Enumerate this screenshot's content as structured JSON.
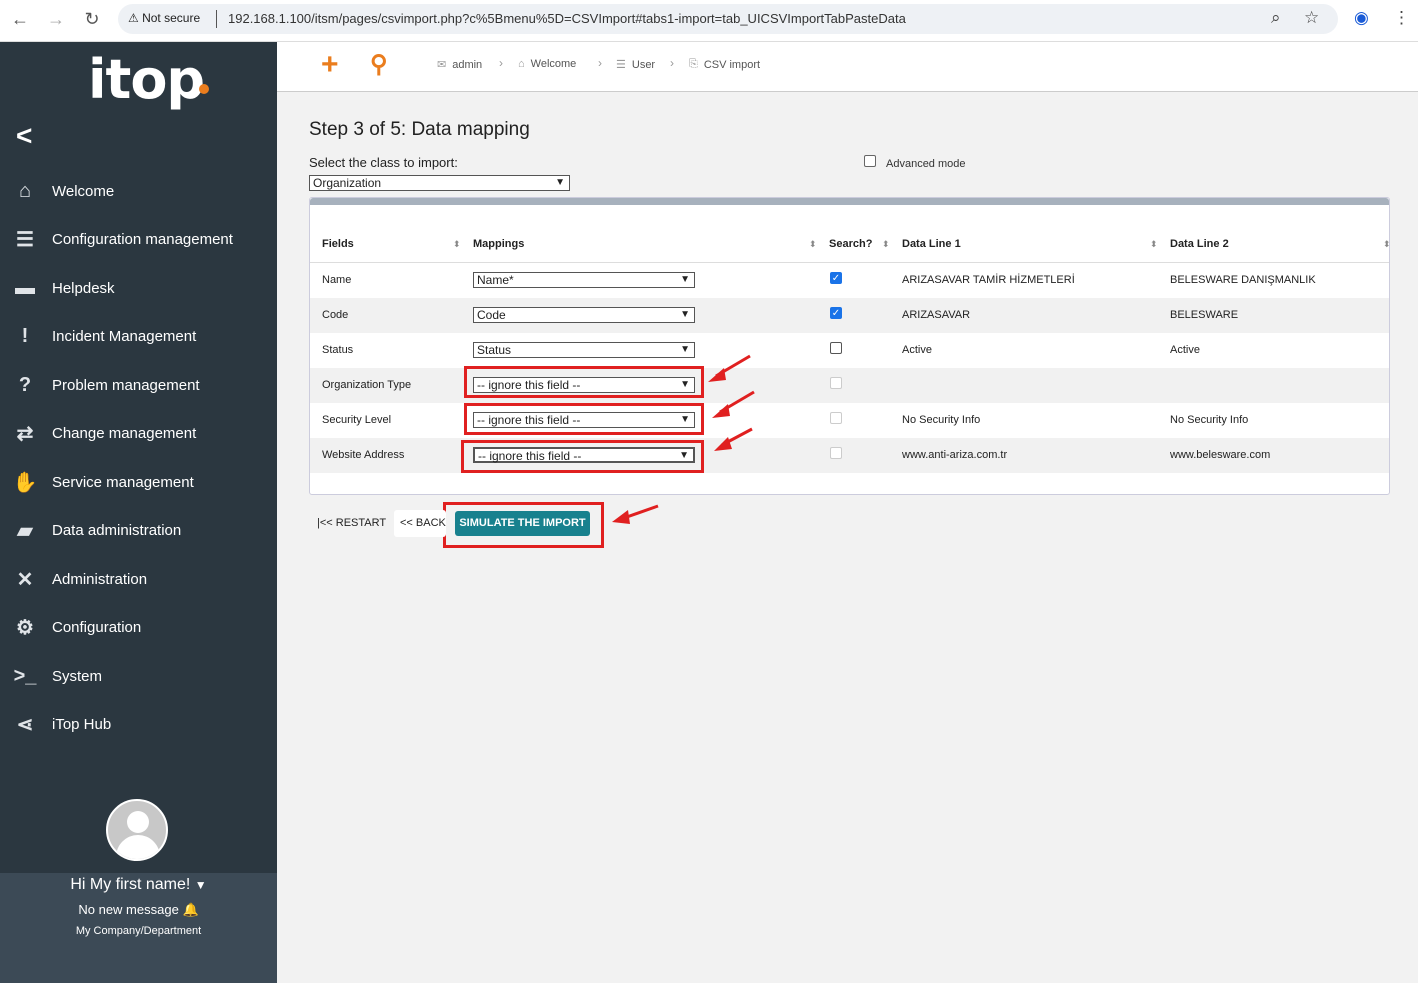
{
  "browser": {
    "security_label": "Not secure",
    "url": "192.168.1.100/itsm/pages/csvimport.php?c%5Bmenu%5D=CSVImport#tabs1-import=tab_UICSVImportTabPasteData"
  },
  "sidebar": {
    "logo": "itop",
    "items": [
      {
        "label": "Welcome",
        "icon": "home-icon"
      },
      {
        "label": "Configuration management",
        "icon": "database-icon"
      },
      {
        "label": "Helpdesk",
        "icon": "chat-icon"
      },
      {
        "label": "Incident Management",
        "icon": "exclamation-icon"
      },
      {
        "label": "Problem management",
        "icon": "question-icon"
      },
      {
        "label": "Change management",
        "icon": "exchange-icon"
      },
      {
        "label": "Service management",
        "icon": "handshake-icon"
      },
      {
        "label": "Data administration",
        "icon": "folder-icon"
      },
      {
        "label": "Administration",
        "icon": "tools-icon"
      },
      {
        "label": "Configuration",
        "icon": "gear-icon"
      },
      {
        "label": "System",
        "icon": "terminal-icon"
      },
      {
        "label": "iTop Hub",
        "icon": "share-icon"
      }
    ],
    "user": {
      "greeting": "Hi My first name!",
      "messages": "No new message",
      "company": "My Company/Department"
    }
  },
  "breadcrumb": [
    "admin",
    "Welcome",
    "User",
    "CSV import"
  ],
  "page": {
    "title": "Step 3 of 5: Data mapping",
    "select_class_label": "Select the class to import:",
    "selected_class": "Organization",
    "advanced_mode": "Advanced mode"
  },
  "table": {
    "headers": [
      "Fields",
      "Mappings",
      "Search?",
      "Data Line 1",
      "Data Line 2"
    ],
    "rows": [
      {
        "field": "Name",
        "mapping": "Name*",
        "search": "checked",
        "line1": "ARIZASAVAR TAMİR HİZMETLERİ",
        "line2": "BELESWARE DANIŞMANLIK"
      },
      {
        "field": "Code",
        "mapping": "Code",
        "search": "checked",
        "line1": "ARIZASAVAR",
        "line2": "BELESWARE"
      },
      {
        "field": "Status",
        "mapping": "Status",
        "search": "unchecked",
        "line1": "Active",
        "line2": "Active"
      },
      {
        "field": "Organization Type",
        "mapping": "-- ignore this field --",
        "search": "disabled",
        "line1": "",
        "line2": ""
      },
      {
        "field": "Security Level",
        "mapping": "-- ignore this field --",
        "search": "disabled",
        "line1": "No Security Info",
        "line2": "No Security Info"
      },
      {
        "field": "Website Address",
        "mapping": "-- ignore this field --",
        "search": "disabled",
        "line1": "www.anti-ariza.com.tr",
        "line2": "www.belesware.com"
      }
    ]
  },
  "buttons": {
    "restart": "|<< RESTART",
    "back": "<< BACK",
    "simulate": "SIMULATE THE IMPORT"
  },
  "colors": {
    "accent": "#ea7d1e",
    "sidebar": "#2b3740",
    "primary_button": "#18818e",
    "highlight": "#e02020"
  }
}
